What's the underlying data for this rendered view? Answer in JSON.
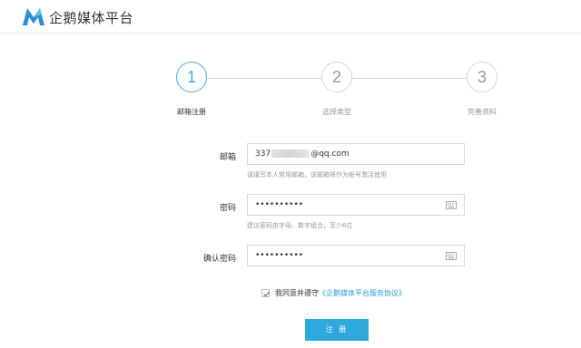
{
  "brand": {
    "name": "企鹅媒体平台"
  },
  "steps": [
    {
      "number": "1",
      "label": "邮箱注册",
      "active": true
    },
    {
      "number": "2",
      "label": "选择类型",
      "active": false
    },
    {
      "number": "3",
      "label": "完善资料",
      "active": false
    }
  ],
  "form": {
    "email": {
      "label": "邮箱",
      "value_prefix": "337",
      "value_suffix": "@qq.com",
      "hint": "请填写本人常用邮箱，该邮箱将作为帐号激活使用"
    },
    "password": {
      "label": "密码",
      "value": "••••••••••",
      "hint": "建议密码由字母、数字组合，至少6位"
    },
    "confirm": {
      "label": "确认密码",
      "value": "••••••••••"
    }
  },
  "agreement": {
    "text": "我同意并遵守",
    "link": "《企鹅媒体平台服务协议》",
    "checked": true
  },
  "submit": {
    "label": "注 册"
  },
  "colors": {
    "accent": "#2fa8de",
    "link": "#2a9bd1",
    "logo": "#2a8fd6"
  }
}
